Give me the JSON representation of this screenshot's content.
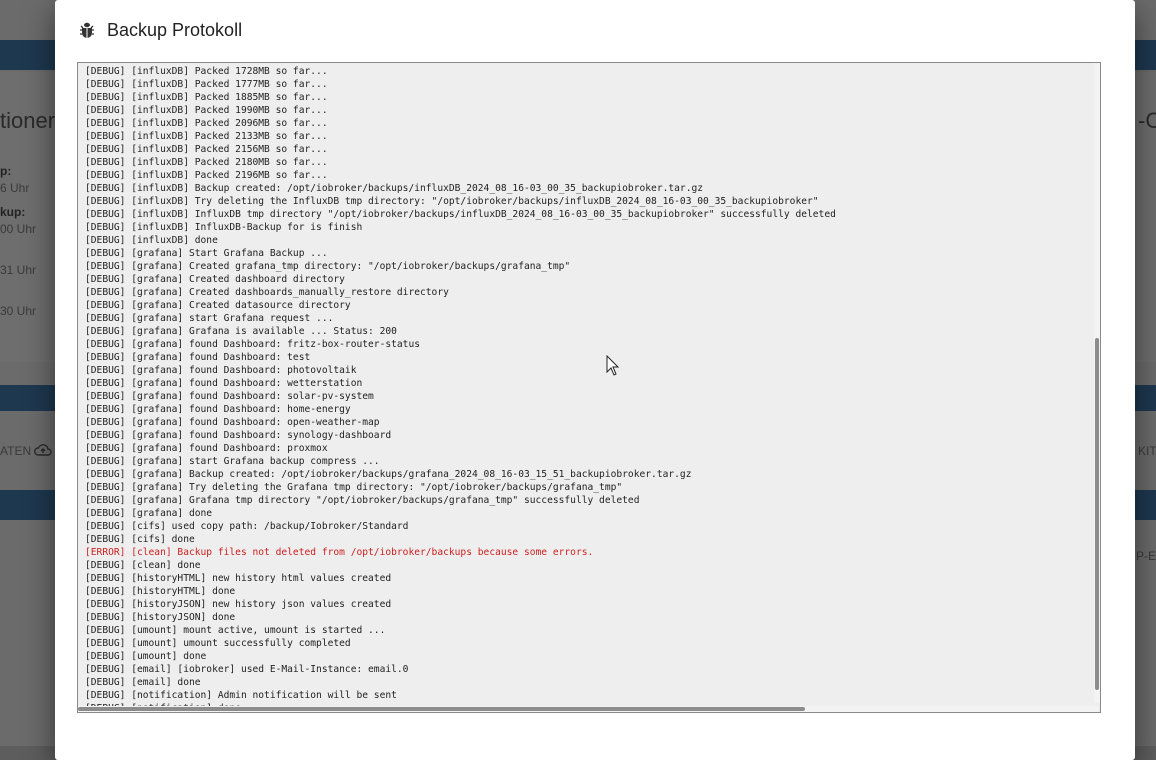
{
  "background": {
    "left_title_fragment": "tioner",
    "right_title_fragment": "-C",
    "labels": [
      {
        "bold": "p:",
        "sub": "6 Uhr"
      },
      {
        "bold": "kup:",
        "sub": "00 Uhr"
      },
      {
        "sub": "31 Uhr"
      },
      {
        "sub": "30 Uhr"
      }
    ],
    "left_button_fragment": "ATEN",
    "right_button_fragment": "KIT",
    "right_field_fragment": "P-E"
  },
  "dialog": {
    "title": "Backup Protokoll",
    "icon": "bug-icon"
  },
  "log": {
    "lines": [
      {
        "text": "[DEBUG] [influxDB] Packed 1728MB so far...",
        "level": "debug"
      },
      {
        "text": "[DEBUG] [influxDB] Packed 1777MB so far...",
        "level": "debug"
      },
      {
        "text": "[DEBUG] [influxDB] Packed 1885MB so far...",
        "level": "debug"
      },
      {
        "text": "[DEBUG] [influxDB] Packed 1990MB so far...",
        "level": "debug"
      },
      {
        "text": "[DEBUG] [influxDB] Packed 2096MB so far...",
        "level": "debug"
      },
      {
        "text": "[DEBUG] [influxDB] Packed 2133MB so far...",
        "level": "debug"
      },
      {
        "text": "[DEBUG] [influxDB] Packed 2156MB so far...",
        "level": "debug"
      },
      {
        "text": "[DEBUG] [influxDB] Packed 2180MB so far...",
        "level": "debug"
      },
      {
        "text": "[DEBUG] [influxDB] Packed 2196MB so far...",
        "level": "debug"
      },
      {
        "text": "[DEBUG] [influxDB] Backup created: /opt/iobroker/backups/influxDB_2024_08_16-03_00_35_backupiobroker.tar.gz",
        "level": "debug"
      },
      {
        "text": "[DEBUG] [influxDB] Try deleting the InfluxDB tmp directory: \"/opt/iobroker/backups/influxDB_2024_08_16-03_00_35_backupiobroker\"",
        "level": "debug"
      },
      {
        "text": "[DEBUG] [influxDB] InfluxDB tmp directory \"/opt/iobroker/backups/influxDB_2024_08_16-03_00_35_backupiobroker\" successfully deleted",
        "level": "debug"
      },
      {
        "text": "[DEBUG] [influxDB] InfluxDB-Backup for is finish",
        "level": "debug"
      },
      {
        "text": "[DEBUG] [influxDB] done",
        "level": "debug"
      },
      {
        "text": "[DEBUG] [grafana] Start Grafana Backup ...",
        "level": "debug"
      },
      {
        "text": "[DEBUG] [grafana] Created grafana_tmp directory: \"/opt/iobroker/backups/grafana_tmp\"",
        "level": "debug"
      },
      {
        "text": "[DEBUG] [grafana] Created dashboard directory",
        "level": "debug"
      },
      {
        "text": "[DEBUG] [grafana] Created dashboards_manually_restore directory",
        "level": "debug"
      },
      {
        "text": "[DEBUG] [grafana] Created datasource directory",
        "level": "debug"
      },
      {
        "text": "[DEBUG] [grafana] start Grafana request ...",
        "level": "debug"
      },
      {
        "text": "[DEBUG] [grafana] Grafana is available ... Status: 200",
        "level": "debug"
      },
      {
        "text": "[DEBUG] [grafana] found Dashboard: fritz-box-router-status",
        "level": "debug"
      },
      {
        "text": "[DEBUG] [grafana] found Dashboard: test",
        "level": "debug"
      },
      {
        "text": "[DEBUG] [grafana] found Dashboard: photovoltaik",
        "level": "debug"
      },
      {
        "text": "[DEBUG] [grafana] found Dashboard: wetterstation",
        "level": "debug"
      },
      {
        "text": "[DEBUG] [grafana] found Dashboard: solar-pv-system",
        "level": "debug"
      },
      {
        "text": "[DEBUG] [grafana] found Dashboard: home-energy",
        "level": "debug"
      },
      {
        "text": "[DEBUG] [grafana] found Dashboard: open-weather-map",
        "level": "debug"
      },
      {
        "text": "[DEBUG] [grafana] found Dashboard: synology-dashboard",
        "level": "debug"
      },
      {
        "text": "[DEBUG] [grafana] found Dashboard: proxmox",
        "level": "debug"
      },
      {
        "text": "[DEBUG] [grafana] start Grafana backup compress ...",
        "level": "debug"
      },
      {
        "text": "[DEBUG] [grafana] Backup created: /opt/iobroker/backups/grafana_2024_08_16-03_15_51_backupiobroker.tar.gz",
        "level": "debug"
      },
      {
        "text": "[DEBUG] [grafana] Try deleting the Grafana tmp directory: \"/opt/iobroker/backups/grafana_tmp\"",
        "level": "debug"
      },
      {
        "text": "[DEBUG] [grafana] Grafana tmp directory \"/opt/iobroker/backups/grafana_tmp\" successfully deleted",
        "level": "debug"
      },
      {
        "text": "[DEBUG] [grafana] done",
        "level": "debug"
      },
      {
        "text": "[DEBUG] [cifs] used copy path: /backup/Iobroker/Standard",
        "level": "debug"
      },
      {
        "text": "[DEBUG] [cifs] done",
        "level": "debug"
      },
      {
        "text": "[ERROR] [clean] Backup files not deleted from /opt/iobroker/backups because some errors.",
        "level": "error"
      },
      {
        "text": "[DEBUG] [clean] done",
        "level": "debug"
      },
      {
        "text": "[DEBUG] [historyHTML] new history html values created",
        "level": "debug"
      },
      {
        "text": "[DEBUG] [historyHTML] done",
        "level": "debug"
      },
      {
        "text": "[DEBUG] [historyJSON] new history json values created",
        "level": "debug"
      },
      {
        "text": "[DEBUG] [historyJSON] done",
        "level": "debug"
      },
      {
        "text": "[DEBUG] [umount] mount active, umount is started ...",
        "level": "debug"
      },
      {
        "text": "[DEBUG] [umount] umount successfully completed",
        "level": "debug"
      },
      {
        "text": "[DEBUG] [umount] done",
        "level": "debug"
      },
      {
        "text": "[DEBUG] [email] [iobroker] used E-Mail-Instance: email.0",
        "level": "debug"
      },
      {
        "text": "[DEBUG] [email] done",
        "level": "debug"
      },
      {
        "text": "[DEBUG] [notification] Admin notification will be sent",
        "level": "debug"
      },
      {
        "text": "[DEBUG] [notification] done",
        "level": "debug"
      }
    ]
  },
  "colors": {
    "error": "#cc1f1f",
    "log_background": "#eeeeee",
    "header_bar": "#1e3850"
  }
}
